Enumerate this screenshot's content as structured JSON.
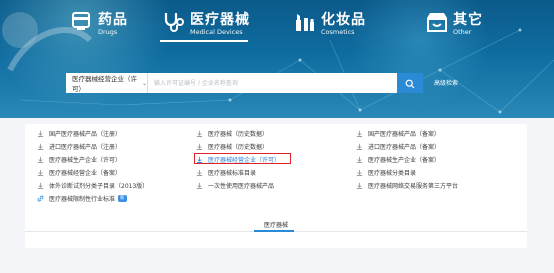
{
  "colors": {
    "accent": "#2a8ad6",
    "highlight_border": "#e0232a",
    "selected_text": "#2a7fd4"
  },
  "categories": [
    {
      "zh": "药品",
      "en": "Drugs",
      "icon": "pill-icon"
    },
    {
      "zh": "医疗器械",
      "en": "Medical Devices",
      "icon": "stethoscope-icon"
    },
    {
      "zh": "化妆品",
      "en": "Cosmetics",
      "icon": "lipstick-icon"
    },
    {
      "zh": "其它",
      "en": "Other",
      "icon": "store-icon"
    }
  ],
  "search": {
    "scope": "医疗器械经营企业（许可）",
    "placeholder": "输入许可证编号 / 企业名称查询",
    "advanced_label": "高级检索"
  },
  "list": [
    [
      "国产医疗器械产品（注册）",
      "医疗器械（历史数据）",
      "国产医疗器械产品（备案）"
    ],
    [
      "进口医疗器械产品（注册）",
      "医疗器械（历史数据）",
      "进口医疗器械产品（备案）"
    ],
    [
      "医疗器械生产企业（许可）",
      "医疗器械经营企业（许可）",
      "医疗器械生产企业（备案）"
    ],
    [
      "医疗器械经营企业（备案）",
      "医疗器械标准目录",
      "医疗器械分类目录"
    ],
    [
      "体外诊断试剂分类子目录（2013版）",
      "一次性使用医疗器械产品",
      "医疗器械网络交易服务第三方平台"
    ],
    [
      "医疗器械限制性行业标准"
    ]
  ],
  "new_badge": "新",
  "panel_tab": "医疗器械"
}
